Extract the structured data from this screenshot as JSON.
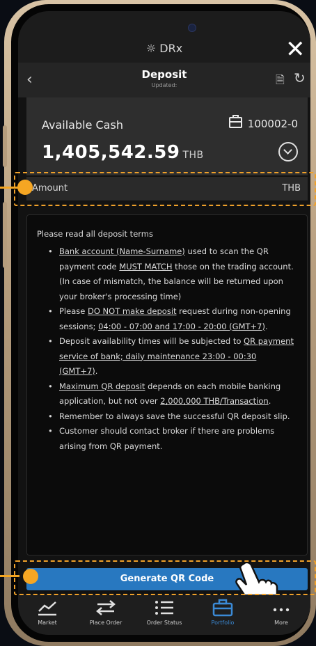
{
  "app": {
    "title": "DRx"
  },
  "nav": {
    "title": "Deposit",
    "subtitle": "Updated:"
  },
  "cash": {
    "label": "Available Cash",
    "account": "100002-0",
    "amount": "1,405,542.59",
    "unit": "THB"
  },
  "amount": {
    "label": "Amount",
    "unit": "THB"
  },
  "terms": {
    "intro": "Please read all deposit terms",
    "items": [
      [
        {
          "t": "Bank account (Name-Surname)",
          "u": true
        },
        {
          "t": " used to scan the QR payment code "
        },
        {
          "t": "MUST MATCH",
          "u": true
        },
        {
          "t": " those on the trading account. (In case of mismatch, the balance will be returned upon your broker's processing time)"
        }
      ],
      [
        {
          "t": "Please "
        },
        {
          "t": "DO NOT make deposit",
          "u": true
        },
        {
          "t": " request during non-opening sessions; "
        },
        {
          "t": "04:00 - 07:00 and 17:00 - 20:00 (GMT+7)",
          "u": true
        },
        {
          "t": "."
        }
      ],
      [
        {
          "t": "Deposit availability times will be subjected to "
        },
        {
          "t": "QR payment service of bank; daily maintenance 23:00 - 00:30 (GMT+7)",
          "u": true
        },
        {
          "t": "."
        }
      ],
      [
        {
          "t": "Maximum QR deposit",
          "u": true
        },
        {
          "t": " depends on each mobile banking application, but not over "
        },
        {
          "t": "2,000,000 THB/Transaction",
          "u": true
        },
        {
          "t": "."
        }
      ],
      [
        {
          "t": "Remember to always save the successful QR deposit slip."
        }
      ],
      [
        {
          "t": "Customer should contact broker if there are problems arising from QR payment."
        }
      ]
    ]
  },
  "button": {
    "generate": "Generate QR Code"
  },
  "tabs": [
    {
      "label": "Market",
      "icon": "market-chart-icon"
    },
    {
      "label": "Place Order",
      "icon": "swap-arrows-icon"
    },
    {
      "label": "Order Status",
      "icon": "list-icon"
    },
    {
      "label": "Portfolio",
      "icon": "briefcase-icon",
      "active": true
    },
    {
      "label": "More",
      "icon": "more-dots-icon"
    }
  ],
  "colors": {
    "accent": "#2878c0",
    "highlight": "#f5a623",
    "active_tab": "#3b8ad6"
  }
}
